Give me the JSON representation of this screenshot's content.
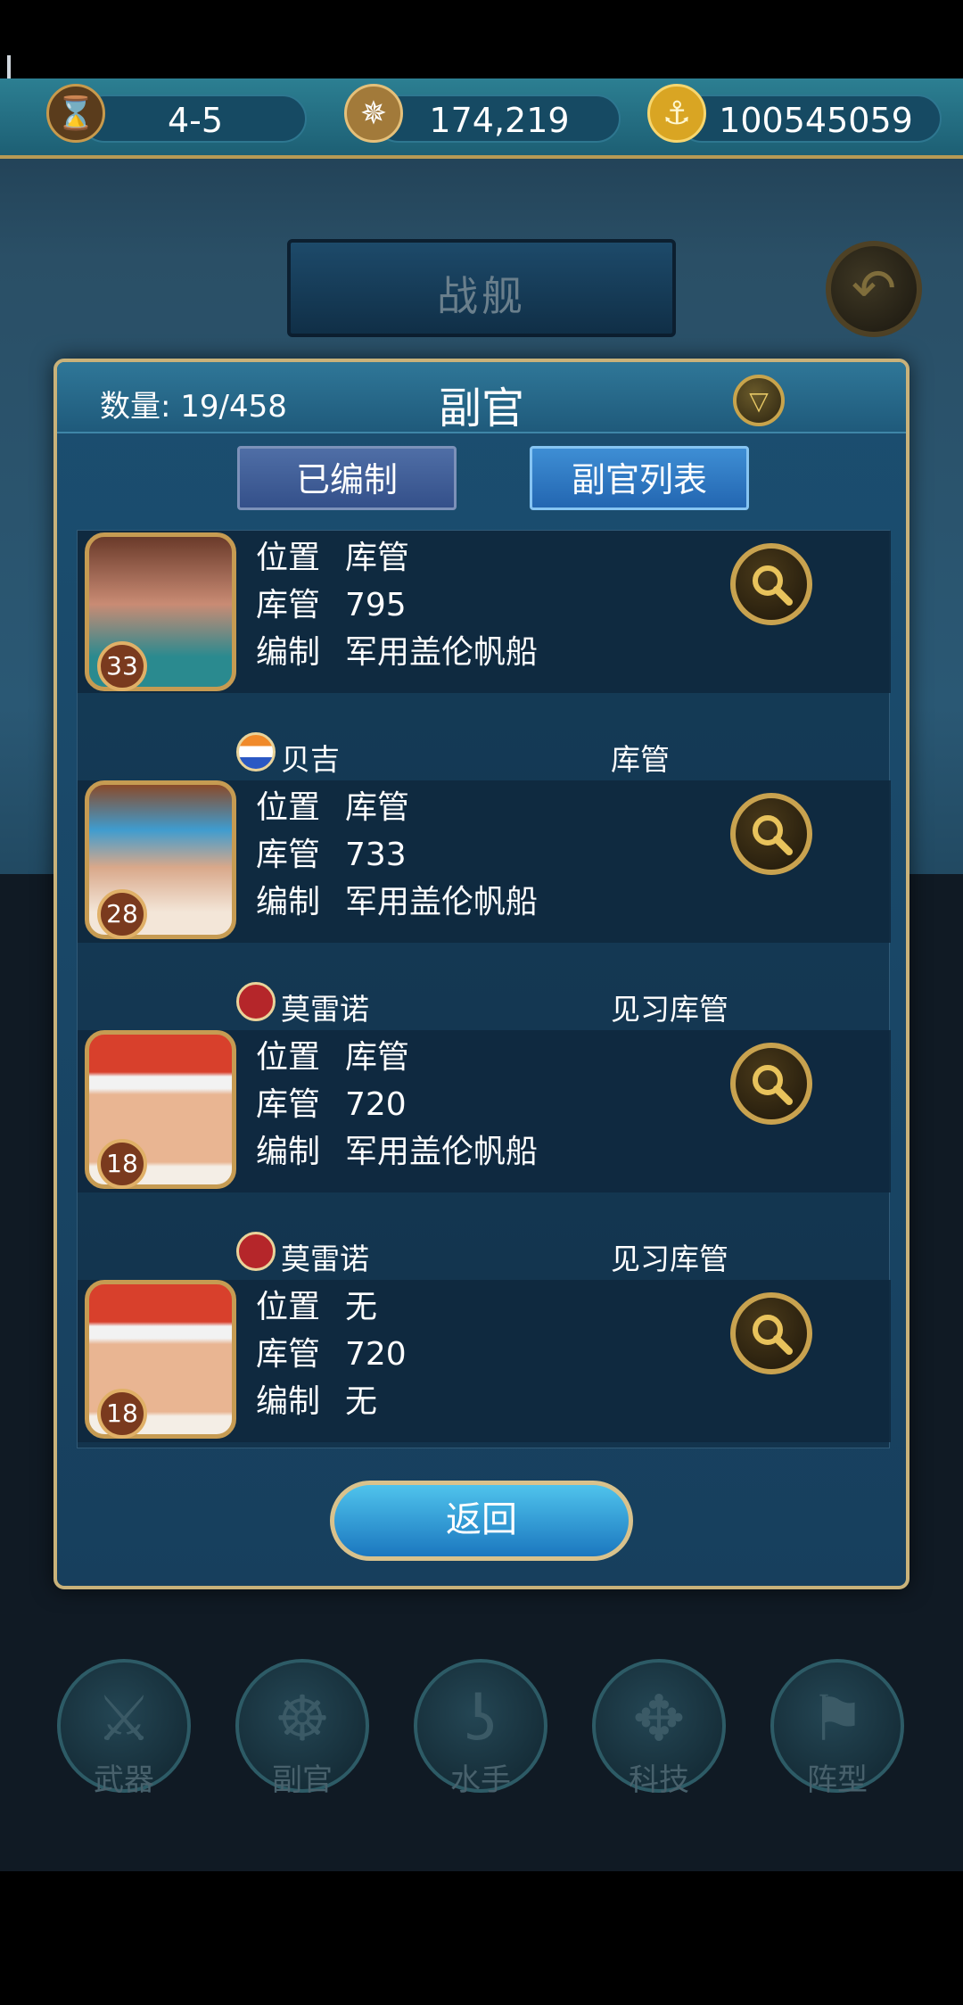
{
  "resources": {
    "stage": "4-5",
    "compass_value": "174,219",
    "gold_value": "100545059"
  },
  "screen_title": "战舰",
  "modal": {
    "title": "副官",
    "count_label": "数量: 19/458",
    "tabs": [
      "已编制",
      "副官列表"
    ]
  },
  "officers": [
    {
      "name": "",
      "role": "",
      "level": "33",
      "position_key": "位置",
      "position": "库管",
      "stat_key": "库管",
      "stat": "795",
      "assign_key": "编制",
      "assign": "军用盖伦帆船"
    },
    {
      "name": "贝吉",
      "role": "库管",
      "level": "28",
      "position_key": "位置",
      "position": "库管",
      "stat_key": "库管",
      "stat": "733",
      "assign_key": "编制",
      "assign": "军用盖伦帆船"
    },
    {
      "name": "莫雷诺",
      "role": "见习库管",
      "level": "18",
      "position_key": "位置",
      "position": "库管",
      "stat_key": "库管",
      "stat": "720",
      "assign_key": "编制",
      "assign": "军用盖伦帆船"
    },
    {
      "name": "莫雷诺",
      "role": "见习库管",
      "level": "18",
      "position_key": "位置",
      "position": "无",
      "stat_key": "库管",
      "stat": "720",
      "assign_key": "编制",
      "assign": "无"
    }
  ],
  "return_label": "返回",
  "bottom_nav": [
    "武器",
    "副官",
    "水手",
    "科技",
    "阵型"
  ]
}
